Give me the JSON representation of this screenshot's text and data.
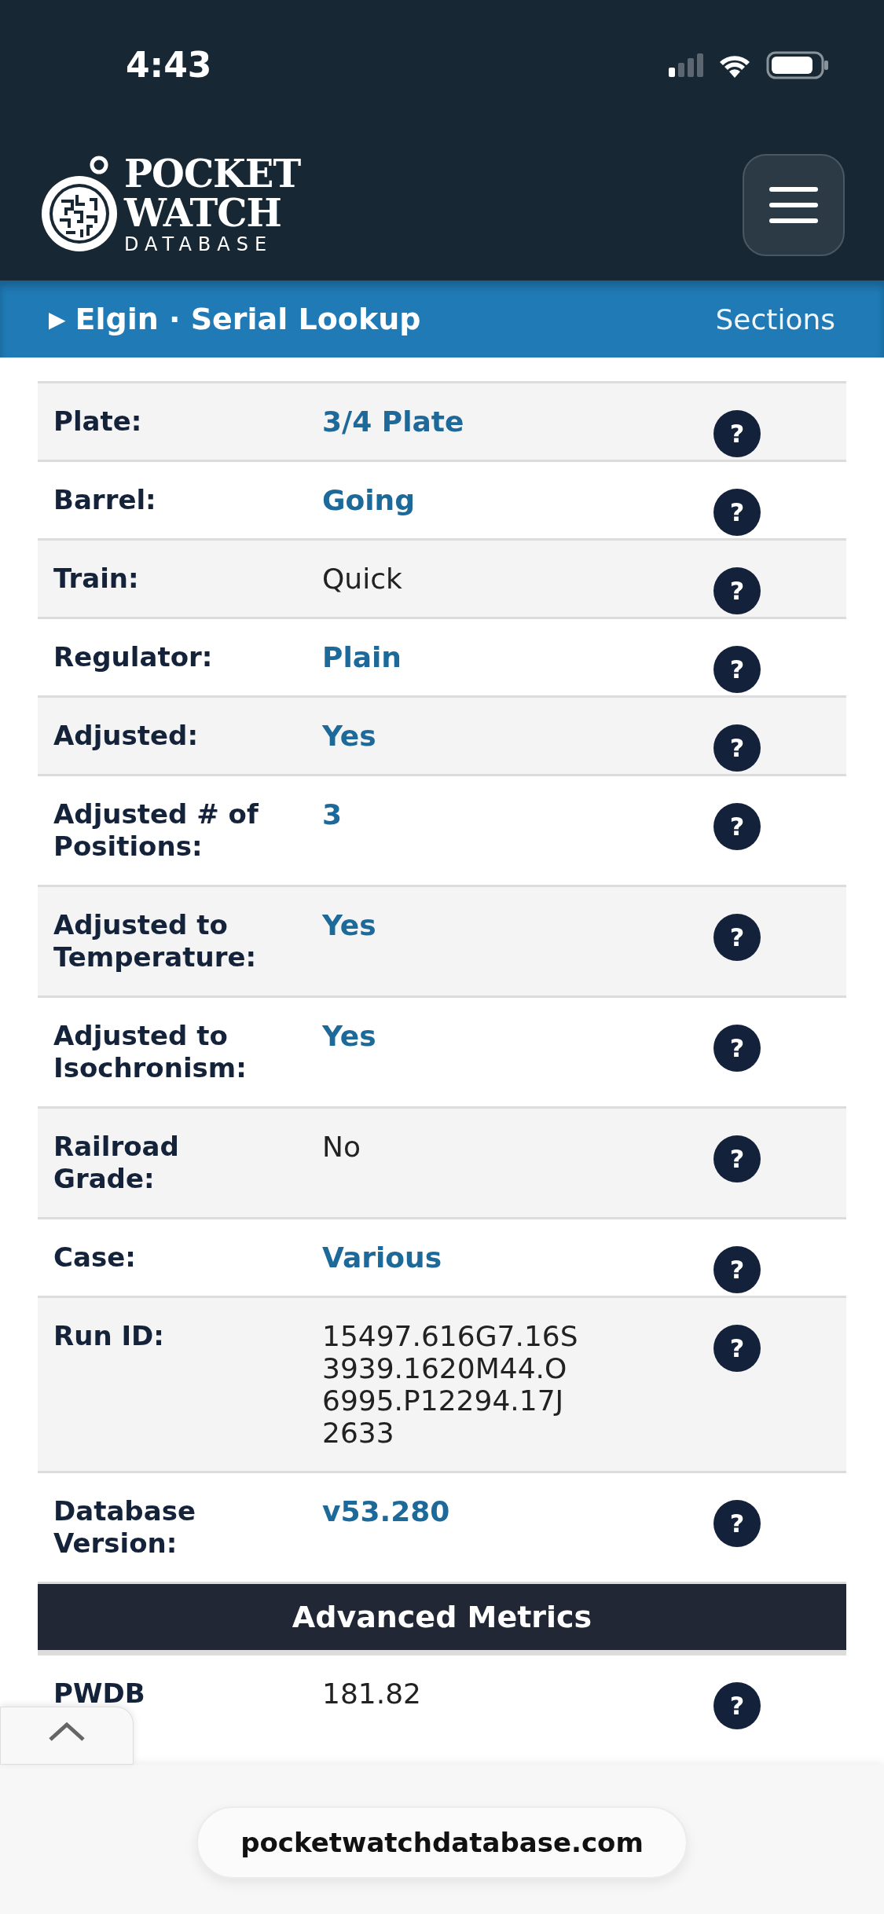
{
  "status_bar": {
    "time": "4:43"
  },
  "header": {
    "logo": {
      "line_1": "POCKET",
      "line_2": "WATCH",
      "line_3": "DATABASE"
    }
  },
  "breadcrumb": {
    "marker": "▶",
    "title": "Elgin · Serial Lookup",
    "sections_link": "Sections"
  },
  "table": {
    "rows": [
      {
        "label": "Plate:",
        "value": "3/4 Plate",
        "kind": "link",
        "help": "?"
      },
      {
        "label": "Barrel:",
        "value": "Going",
        "kind": "link",
        "help": "?"
      },
      {
        "label": "Train:",
        "value": "Quick",
        "kind": "text",
        "help": "?"
      },
      {
        "label": "Regulator:",
        "value": "Plain",
        "kind": "link",
        "help": "?"
      },
      {
        "label": "Adjusted:",
        "value": "Yes",
        "kind": "link",
        "help": "?"
      },
      {
        "label": "Adjusted # of Positions:",
        "value": "3",
        "kind": "link",
        "help": "?"
      },
      {
        "label": "Adjusted to Temperature:",
        "value": "Yes",
        "kind": "link",
        "help": "?"
      },
      {
        "label": "Adjusted to Isochronism:",
        "value": "Yes",
        "kind": "link",
        "help": "?"
      },
      {
        "label": "Railroad Grade:",
        "value": "No",
        "kind": "text",
        "help": "?"
      },
      {
        "label": "Case:",
        "value": "Various",
        "kind": "link",
        "help": "?"
      },
      {
        "label": "Run ID:",
        "value": "15497.616G7.16S3939.1620M44.O6995.P12294.17J2633",
        "kind": "text",
        "help": "?"
      },
      {
        "label": "Database Version:",
        "value": "v53.280",
        "kind": "link",
        "help": "?"
      }
    ],
    "section_heading": "Advanced Metrics",
    "advanced_rows": [
      {
        "label": "PWDB",
        "value": "181.82",
        "kind": "text",
        "help": "?"
      }
    ]
  },
  "browser_bar": {
    "url": "pocketwatchdatabase.com"
  }
}
